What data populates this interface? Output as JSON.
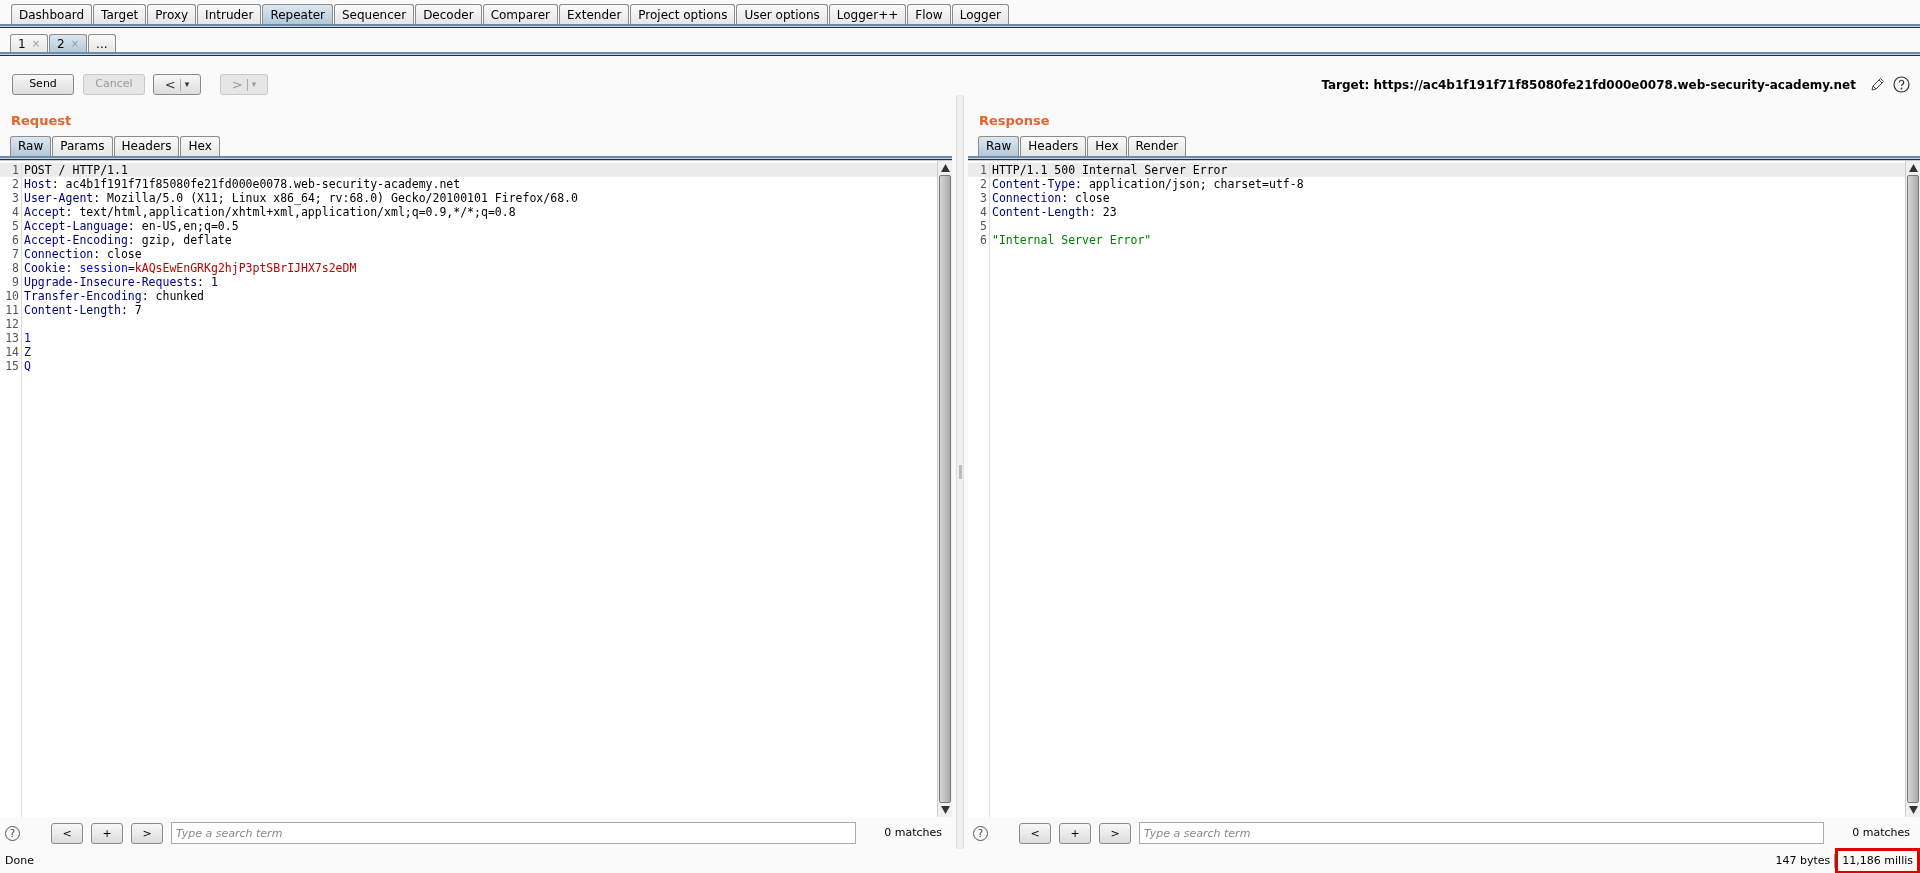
{
  "main_tabs": [
    {
      "label": "Dashboard",
      "selected": false
    },
    {
      "label": "Target",
      "selected": false
    },
    {
      "label": "Proxy",
      "selected": false
    },
    {
      "label": "Intruder",
      "selected": false
    },
    {
      "label": "Repeater",
      "selected": true
    },
    {
      "label": "Sequencer",
      "selected": false
    },
    {
      "label": "Decoder",
      "selected": false
    },
    {
      "label": "Comparer",
      "selected": false
    },
    {
      "label": "Extender",
      "selected": false
    },
    {
      "label": "Project options",
      "selected": false
    },
    {
      "label": "User options",
      "selected": false
    },
    {
      "label": "Logger++",
      "selected": false
    },
    {
      "label": "Flow",
      "selected": false
    },
    {
      "label": "Logger",
      "selected": false
    }
  ],
  "sub_tabs": [
    {
      "label": "1",
      "close": "×",
      "selected": false
    },
    {
      "label": "2",
      "close": "×",
      "selected": true
    },
    {
      "label": "...",
      "selected": false
    }
  ],
  "toolbar": {
    "send": {
      "label": "Send",
      "disabled": false
    },
    "cancel": {
      "label": "Cancel",
      "disabled": true
    },
    "back": {
      "label": "<",
      "menu": "▾",
      "disabled": false
    },
    "forward": {
      "label": ">",
      "menu": "▾",
      "disabled": true
    },
    "target": "Target: https://ac4b1f191f71f85080fe21fd000e0078.web-security-academy.net"
  },
  "panes": [
    {
      "title": "Request",
      "tabs": [
        {
          "label": "Raw",
          "selected": true
        },
        {
          "label": "Params",
          "selected": false
        },
        {
          "label": "Headers",
          "selected": false
        },
        {
          "label": "Hex",
          "selected": false
        }
      ],
      "lines": [
        {
          "number": "1",
          "current": true,
          "parts": [
            {
              "kind": "plain",
              "text": "POST / HTTP/1.1"
            }
          ]
        },
        {
          "number": "2",
          "current": false,
          "parts": [
            {
              "kind": "name",
              "text": "Host"
            },
            {
              "kind": "plain",
              "text": ": ac4b1f191f71f85080fe21fd000e0078.web-security-academy.net"
            }
          ]
        },
        {
          "number": "3",
          "current": false,
          "parts": [
            {
              "kind": "name",
              "text": "User-Agent"
            },
            {
              "kind": "plain",
              "text": ": Mozilla/5.0 (X11; Linux x86_64; rv:68.0) Gecko/20100101 Firefox/68.0"
            }
          ]
        },
        {
          "number": "4",
          "current": false,
          "parts": [
            {
              "kind": "name",
              "text": "Accept"
            },
            {
              "kind": "plain",
              "text": ": text/html,application/xhtml+xml,application/xml;q=0.9,*/*;q=0.8"
            }
          ]
        },
        {
          "number": "5",
          "current": false,
          "parts": [
            {
              "kind": "name",
              "text": "Accept-Language"
            },
            {
              "kind": "plain",
              "text": ": en-US,en;q=0.5"
            }
          ]
        },
        {
          "number": "6",
          "current": false,
          "parts": [
            {
              "kind": "name",
              "text": "Accept-Encoding"
            },
            {
              "kind": "plain",
              "text": ": gzip, deflate"
            }
          ]
        },
        {
          "number": "7",
          "current": false,
          "parts": [
            {
              "kind": "name",
              "text": "Connection"
            },
            {
              "kind": "plain",
              "text": ": close"
            }
          ]
        },
        {
          "number": "8",
          "current": false,
          "parts": [
            {
              "kind": "name",
              "text": "Cookie"
            },
            {
              "kind": "plain",
              "text": ": "
            },
            {
              "kind": "param",
              "text": "session"
            },
            {
              "kind": "plain",
              "text": "="
            },
            {
              "kind": "value",
              "text": "kAQsEwEnGRKg2hjP3ptSBrIJHX7s2eDM"
            }
          ]
        },
        {
          "number": "9",
          "current": false,
          "parts": [
            {
              "kind": "name",
              "text": "Upgrade-Insecure-Requests"
            },
            {
              "kind": "plain",
              "text": ": 1"
            }
          ]
        },
        {
          "number": "10",
          "current": false,
          "parts": [
            {
              "kind": "name",
              "text": "Transfer-Encoding"
            },
            {
              "kind": "plain",
              "text": ": chunked"
            }
          ]
        },
        {
          "number": "11",
          "current": false,
          "parts": [
            {
              "kind": "name",
              "text": "Content-Length"
            },
            {
              "kind": "plain",
              "text": ": 7"
            }
          ]
        },
        {
          "number": "12",
          "current": false
        },
        {
          "number": "13",
          "current": false,
          "parts": [
            {
              "kind": "body",
              "text": "1"
            }
          ]
        },
        {
          "number": "14",
          "current": false,
          "parts": [
            {
              "kind": "body",
              "text": "Z"
            }
          ]
        },
        {
          "number": "15",
          "current": false,
          "parts": [
            {
              "kind": "body",
              "text": "Q"
            }
          ]
        }
      ],
      "search": {
        "help": "?",
        "prev": "<",
        "add": "+",
        "next": ">",
        "placeholder": "Type a search term",
        "matches": "0 matches"
      }
    },
    {
      "title": "Response",
      "tabs": [
        {
          "label": "Raw",
          "selected": true
        },
        {
          "label": "Headers",
          "selected": false
        },
        {
          "label": "Hex",
          "selected": false
        },
        {
          "label": "Render",
          "selected": false
        }
      ],
      "lines": [
        {
          "number": "1",
          "current": true,
          "parts": [
            {
              "kind": "plain",
              "text": "HTTP/1.1 500 Internal Server Error"
            }
          ]
        },
        {
          "number": "2",
          "current": false,
          "parts": [
            {
              "kind": "name",
              "text": "Content-Type"
            },
            {
              "kind": "plain",
              "text": ": application/json; charset=utf-8"
            }
          ]
        },
        {
          "number": "3",
          "current": false,
          "parts": [
            {
              "kind": "name",
              "text": "Connection"
            },
            {
              "kind": "plain",
              "text": ": close"
            }
          ]
        },
        {
          "number": "4",
          "current": false,
          "parts": [
            {
              "kind": "name",
              "text": "Content-Length"
            },
            {
              "kind": "plain",
              "text": ": 23"
            }
          ]
        },
        {
          "number": "5",
          "current": false
        },
        {
          "number": "6",
          "current": false,
          "parts": [
            {
              "kind": "string",
              "text": "\"Internal Server Error\""
            }
          ]
        }
      ],
      "search": {
        "help": "?",
        "prev": "<",
        "add": "+",
        "next": ">",
        "placeholder": "Type a search term",
        "matches": "0 matches"
      }
    }
  ],
  "status_bar": {
    "left": "Done",
    "bytes": "147 bytes",
    "time": "11,186 millis",
    "time_highlighted": true
  }
}
